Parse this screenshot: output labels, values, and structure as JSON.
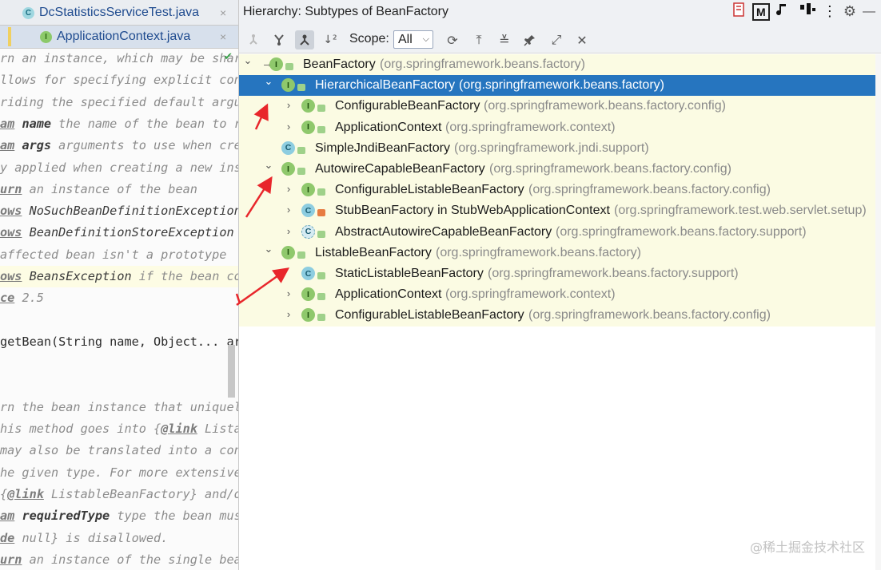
{
  "editor": {
    "tabs": [
      {
        "label": "DcStatisticsServiceTest.java",
        "icon": "C"
      },
      {
        "label": "ApplicationContext.java",
        "icon": "I"
      }
    ],
    "close_glyph": "×",
    "code_lines": [
      {
        "parts": [
          [
            "t",
            "rn an instance, which may be shar"
          ]
        ]
      },
      {
        "parts": [
          [
            "t",
            "llows for specifying explicit con"
          ]
        ]
      },
      {
        "parts": [
          [
            "t",
            "riding the specified default argu"
          ]
        ]
      },
      {
        "parts": [
          [
            "tag",
            "am"
          ],
          [
            "t",
            " "
          ],
          [
            "pn",
            "name"
          ],
          [
            "t",
            " the name of the bean to r"
          ]
        ]
      },
      {
        "parts": [
          [
            "tag",
            "am"
          ],
          [
            "t",
            " "
          ],
          [
            "pn",
            "args"
          ],
          [
            "t",
            " arguments to use when cre"
          ]
        ]
      },
      {
        "parts": [
          [
            "t",
            "y applied when creating a new ins"
          ]
        ]
      },
      {
        "parts": [
          [
            "tag",
            "urn"
          ],
          [
            "t",
            " an instance of the bean"
          ]
        ]
      },
      {
        "parts": [
          [
            "tag",
            "ows"
          ],
          [
            "t",
            " "
          ],
          [
            "ex",
            "NoSuchBeanDefinitionException"
          ]
        ]
      },
      {
        "parts": [
          [
            "tag",
            "ows"
          ],
          [
            "t",
            " "
          ],
          [
            "ex",
            "BeanDefinitionStoreException"
          ]
        ]
      },
      {
        "parts": [
          [
            "t",
            "affected bean isn't a prototype"
          ]
        ]
      },
      {
        "parts": [
          [
            "tag",
            "ows"
          ],
          [
            "t",
            " "
          ],
          [
            "ex",
            "BeansException"
          ],
          [
            "t",
            " if the bean co"
          ]
        ],
        "hl": true
      },
      {
        "parts": [
          [
            "tag",
            "ce"
          ],
          [
            "t",
            " 2.5"
          ]
        ]
      },
      {
        "parts": [
          [
            "t",
            ""
          ]
        ]
      },
      {
        "parts": [
          [
            "t",
            "getBean(String name, Object... ar"
          ]
        ],
        "plain": true
      },
      {
        "parts": [
          [
            "t",
            ""
          ]
        ]
      },
      {
        "parts": [
          [
            "t",
            ""
          ]
        ]
      },
      {
        "parts": [
          [
            "t",
            "rn the bean instance that uniquel"
          ]
        ]
      },
      {
        "parts": [
          [
            "t",
            "his method goes into {"
          ],
          [
            "tag",
            "@link"
          ],
          [
            "t",
            " Lista"
          ]
        ]
      },
      {
        "parts": [
          [
            "t",
            "may also be translated into a con"
          ]
        ]
      },
      {
        "parts": [
          [
            "t",
            "he given type. For more extensive"
          ]
        ]
      },
      {
        "parts": [
          [
            "t",
            "{"
          ],
          [
            "tag",
            "@link"
          ],
          [
            "t",
            " ListableBeanFactory} and/o"
          ]
        ]
      },
      {
        "parts": [
          [
            "tag",
            "am"
          ],
          [
            "t",
            " "
          ],
          [
            "pn",
            "requiredType"
          ],
          [
            "t",
            " type the bean mus"
          ]
        ]
      },
      {
        "parts": [
          [
            "tag",
            "de"
          ],
          [
            "t",
            " null} is disallowed."
          ]
        ]
      },
      {
        "parts": [
          [
            "tag",
            "urn"
          ],
          [
            "t",
            " an instance of the single bea"
          ]
        ]
      }
    ]
  },
  "hierarchy": {
    "title": "Hierarchy:  Subtypes of BeanFactory",
    "scope_label": "Scope:",
    "scope_value": "All",
    "header_icons": [
      "bookmark-icon",
      "m-icon",
      "note-icon",
      "dots-icon",
      "settings-icon",
      "minimize-icon"
    ],
    "header_glyphs": {
      "m": "M",
      "gear": "⚙",
      "minimize": "—",
      "more": "⋮"
    },
    "toolbar": [
      {
        "name": "supertypes-icon",
        "glyph": "⅄",
        "disabled": true
      },
      {
        "name": "subtypes-icon",
        "glyph": "Y"
      },
      {
        "name": "type-hierarchy-icon",
        "glyph": "⅄",
        "active": true
      },
      {
        "name": "sort-alpha-icon",
        "glyph": "↓²"
      },
      {
        "name": "refresh-icon",
        "glyph": "⟳"
      },
      {
        "name": "export-icon",
        "glyph": "⤒"
      },
      {
        "name": "expand-all-icon",
        "glyph": "≚"
      },
      {
        "name": "pin-icon",
        "glyph": "✎"
      },
      {
        "name": "autoscroll-icon",
        "glyph": "⤢"
      },
      {
        "name": "close-icon",
        "glyph": "✕"
      }
    ],
    "rows": [
      {
        "name": "BeanFactory",
        "pkg": "(org.springframework.beans.factory)",
        "kind": "iface",
        "depth": 0,
        "arrow": "⌄",
        "root": true
      },
      {
        "name": "HierarchicalBeanFactory",
        "pkg": "(org.springframework.beans.factory)",
        "kind": "iface",
        "depth": 1,
        "arrow": "⌄",
        "selected": true
      },
      {
        "name": "ConfigurableBeanFactory",
        "pkg": "(org.springframework.beans.factory.config)",
        "kind": "iface",
        "depth": 2,
        "arrow": "›"
      },
      {
        "name": "ApplicationContext",
        "pkg": "(org.springframework.context)",
        "kind": "iface",
        "depth": 2,
        "arrow": "›"
      },
      {
        "name": "SimpleJndiBeanFactory",
        "pkg": "(org.springframework.jndi.support)",
        "kind": "klass",
        "depth": 1,
        "arrow": ""
      },
      {
        "name": "AutowireCapableBeanFactory",
        "pkg": "(org.springframework.beans.factory.config)",
        "kind": "iface",
        "depth": 1,
        "arrow": "⌄"
      },
      {
        "name": "ConfigurableListableBeanFactory",
        "pkg": "(org.springframework.beans.factory.config)",
        "kind": "iface",
        "depth": 2,
        "arrow": "›"
      },
      {
        "name": "StubBeanFactory in StubWebApplicationContext",
        "pkg": "(org.springframework.test.web.servlet.setup)",
        "kind": "klass",
        "depth": 2,
        "arrow": "›",
        "private": true
      },
      {
        "name": "AbstractAutowireCapableBeanFactory",
        "pkg": "(org.springframework.beans.factory.support)",
        "kind": "abstract",
        "depth": 2,
        "arrow": "›"
      },
      {
        "name": "ListableBeanFactory",
        "pkg": "(org.springframework.beans.factory)",
        "kind": "iface",
        "depth": 1,
        "arrow": "⌄"
      },
      {
        "name": "StaticListableBeanFactory",
        "pkg": "(org.springframework.beans.factory.support)",
        "kind": "klass",
        "depth": 2,
        "arrow": ""
      },
      {
        "name": "ApplicationContext",
        "pkg": "(org.springframework.context)",
        "kind": "iface",
        "depth": 2,
        "arrow": "›"
      },
      {
        "name": "ConfigurableListableBeanFactory",
        "pkg": "(org.springframework.beans.factory.config)",
        "kind": "iface",
        "depth": 2,
        "arrow": "›"
      }
    ]
  },
  "watermark": "@稀土掘金技术社区",
  "colors": {
    "selection": "#2675bf",
    "tree_bg": "#fbfbe3",
    "annotation_arrow": "#e8262b"
  }
}
